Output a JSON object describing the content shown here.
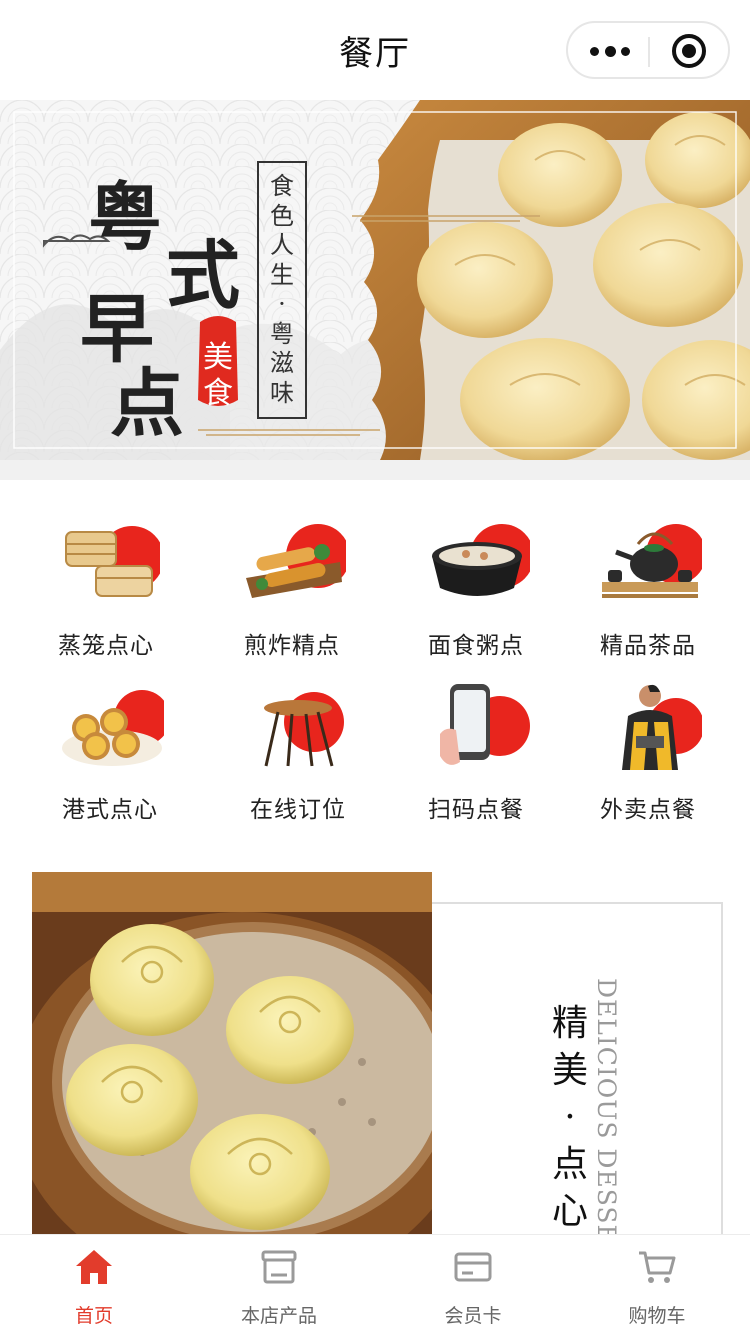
{
  "nav": {
    "title": "餐厅"
  },
  "banner": {
    "title_chars": [
      "粤",
      "式",
      "早",
      "点"
    ],
    "seal_chars": [
      "美",
      "食"
    ],
    "tagline": [
      "食",
      "色",
      "人",
      "生",
      "·",
      "粤",
      "滋",
      "味"
    ]
  },
  "categories": [
    {
      "label": "蒸笼点心",
      "icon": "steamer-basket-icon"
    },
    {
      "label": "煎炸精点",
      "icon": "spring-rolls-icon"
    },
    {
      "label": "面食粥点",
      "icon": "congee-bowl-icon"
    },
    {
      "label": "精品茶品",
      "icon": "teapot-set-icon"
    },
    {
      "label": "港式点心",
      "icon": "egg-tarts-icon"
    },
    {
      "label": "在线订位",
      "icon": "table-icon"
    },
    {
      "label": "扫码点餐",
      "icon": "phone-scan-icon"
    },
    {
      "label": "外卖点餐",
      "icon": "delivery-person-icon"
    }
  ],
  "feature": {
    "slash": "/",
    "title_chars": [
      "精",
      "美",
      "·",
      "点",
      "心"
    ],
    "subtitle": "DELICIOUS DESSERT"
  },
  "tabbar": {
    "active_color": "#e23c2c",
    "items": [
      {
        "label": "首页",
        "icon": "home-icon",
        "active": true
      },
      {
        "label": "本店产品",
        "icon": "archive-box-icon",
        "active": false
      },
      {
        "label": "会员卡",
        "icon": "card-icon",
        "active": false
      },
      {
        "label": "购物车",
        "icon": "cart-icon",
        "active": false
      }
    ]
  }
}
